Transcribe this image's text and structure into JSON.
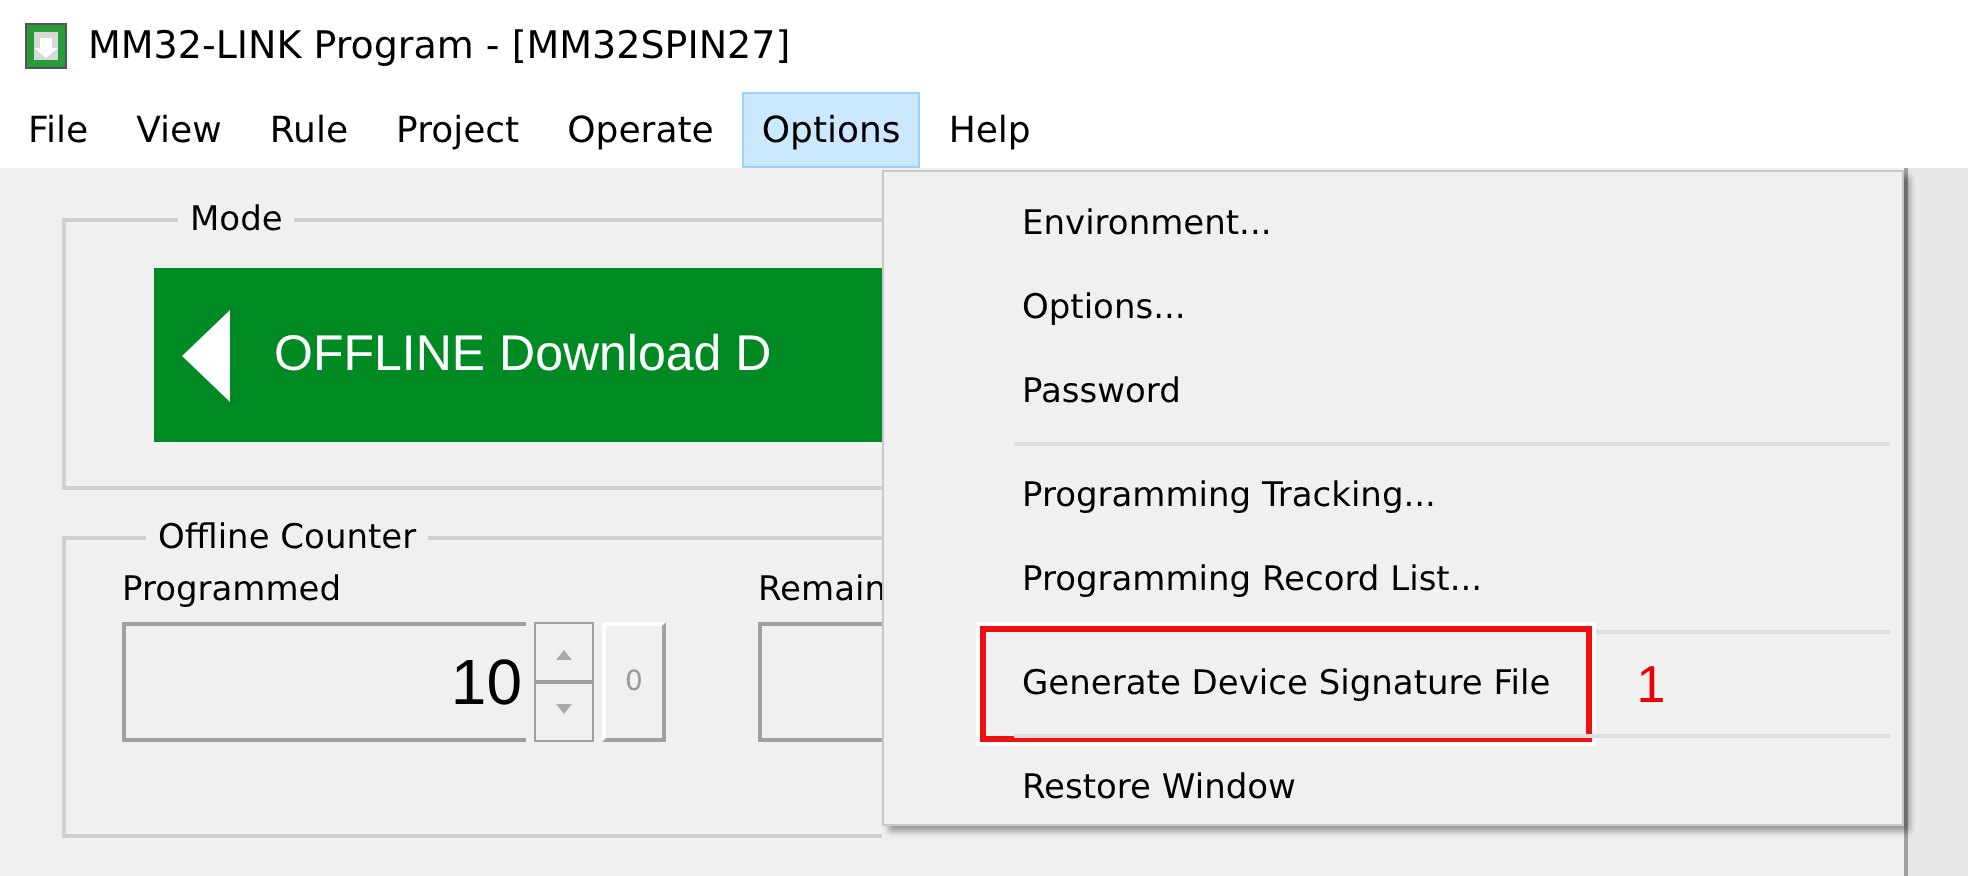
{
  "window": {
    "title": "MM32-LINK Program - [MM32SPIN27]"
  },
  "menu_bar": [
    {
      "label": "File",
      "selected": false
    },
    {
      "label": "View",
      "selected": false
    },
    {
      "label": "Rule",
      "selected": false
    },
    {
      "label": "Project",
      "selected": false
    },
    {
      "label": "Operate",
      "selected": false
    },
    {
      "label": "Options",
      "selected": true
    },
    {
      "label": "Help",
      "selected": false
    }
  ],
  "mode": {
    "title": "Mode",
    "banner": "OFFLINE Download D"
  },
  "offline_counter": {
    "title": "Offline Counter",
    "programmed": {
      "label": "Programmed",
      "value": "10",
      "reset_button": "0"
    },
    "remain": {
      "label": "Remain"
    }
  },
  "options_menu": [
    {
      "kind": "item",
      "label": "Environment...",
      "highlighted": false
    },
    {
      "kind": "item",
      "label": "Options...",
      "highlighted": false
    },
    {
      "kind": "item",
      "label": "Password",
      "highlighted": false
    },
    {
      "kind": "separator"
    },
    {
      "kind": "item",
      "label": "Programming Tracking...",
      "highlighted": false
    },
    {
      "kind": "item",
      "label": "Programming Record List...",
      "highlighted": false
    },
    {
      "kind": "separator"
    },
    {
      "kind": "item",
      "label": "Generate Device Signature File",
      "highlighted": true,
      "callout": "1"
    },
    {
      "kind": "separator"
    },
    {
      "kind": "item",
      "label": "Restore Window",
      "highlighted": false
    }
  ]
}
